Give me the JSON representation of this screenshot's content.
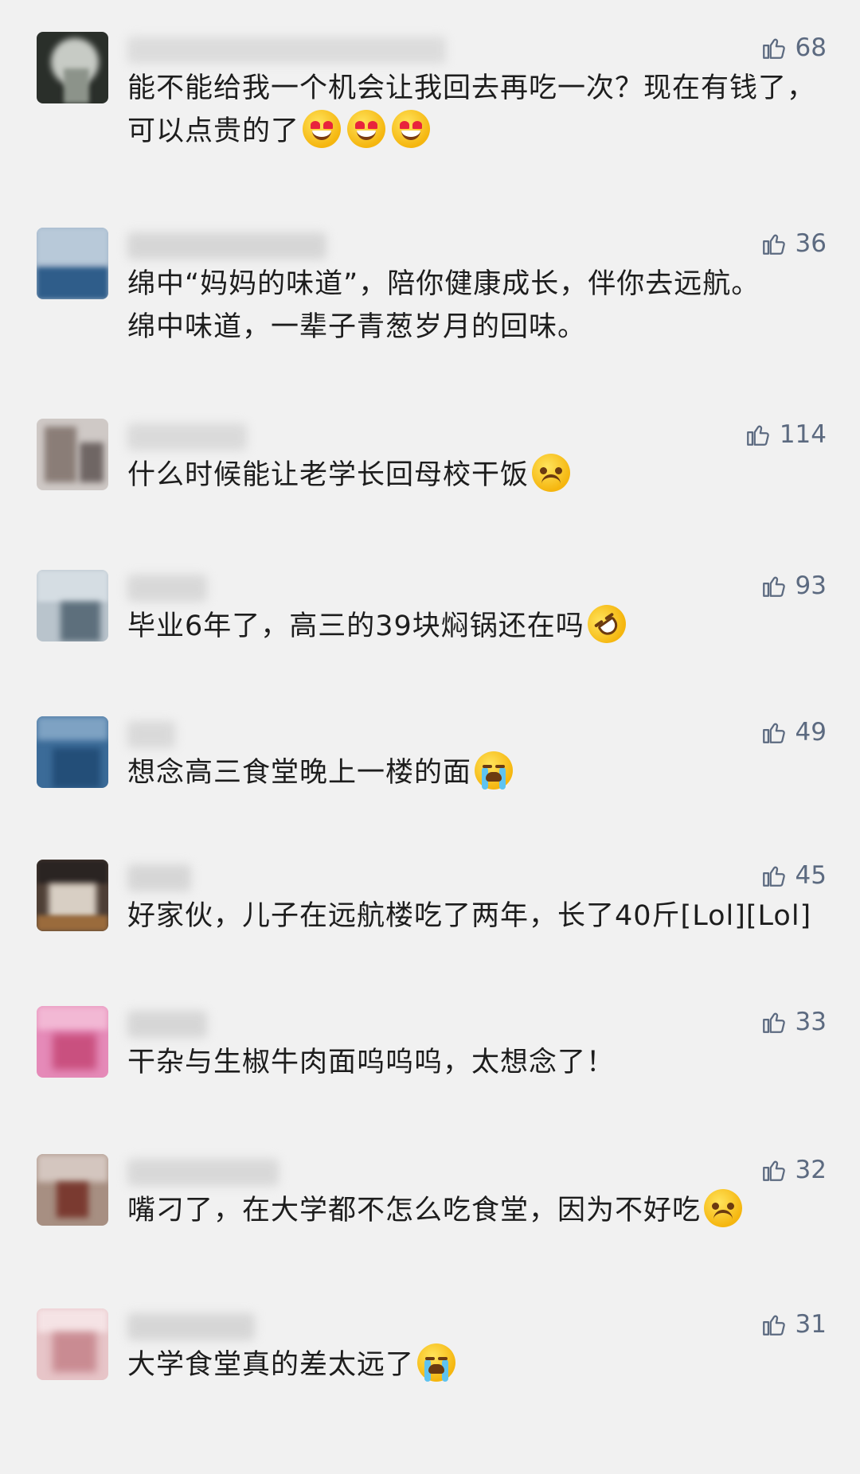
{
  "comments": [
    {
      "likes": "68",
      "text_before": "能不能给我一个机会让我回去再吃一次？现在有钱了，可以点贵的了",
      "emojis": [
        "heart-eyes-emoji",
        "heart-eyes-emoji",
        "heart-eyes-emoji"
      ]
    },
    {
      "likes": "36",
      "line1": "绵中“妈妈的味道”，陪你健康成长，伴你去远航。",
      "line2": "绵中味道，一辈子青葱岁月的回味。"
    },
    {
      "likes": "114",
      "text_before": "什么时候能让老学长回母校干饭",
      "emojis": [
        "disappointed-emoji"
      ]
    },
    {
      "likes": "93",
      "text_before": "毕业6年了，高三的39块焖锅还在吗",
      "emojis": [
        "rofl-emoji"
      ]
    },
    {
      "likes": "49",
      "text_before": "想念高三食堂晚上一楼的面",
      "emojis": [
        "crying-emoji"
      ]
    },
    {
      "likes": "45",
      "text_before": "好家伙，儿子在远航楼吃了两年，长了40斤[Lol][Lol]"
    },
    {
      "likes": "33",
      "text_before": "干杂与生椒牛肉面呜呜呜，太想念了！"
    },
    {
      "likes": "32",
      "text_before": "嘴刁了，在大学都不怎么吃食堂，因为不好吃",
      "emojis": [
        "sad-emoji"
      ]
    },
    {
      "likes": "31",
      "text_before": "大学食堂真的差太远了",
      "emojis": [
        "crying-emoji"
      ]
    }
  ],
  "colors": {
    "background": "#f1f1f1",
    "text": "#1d1d1d",
    "like_count": "#5c6a80"
  },
  "icons": {
    "like": "thumbs-up-icon"
  }
}
